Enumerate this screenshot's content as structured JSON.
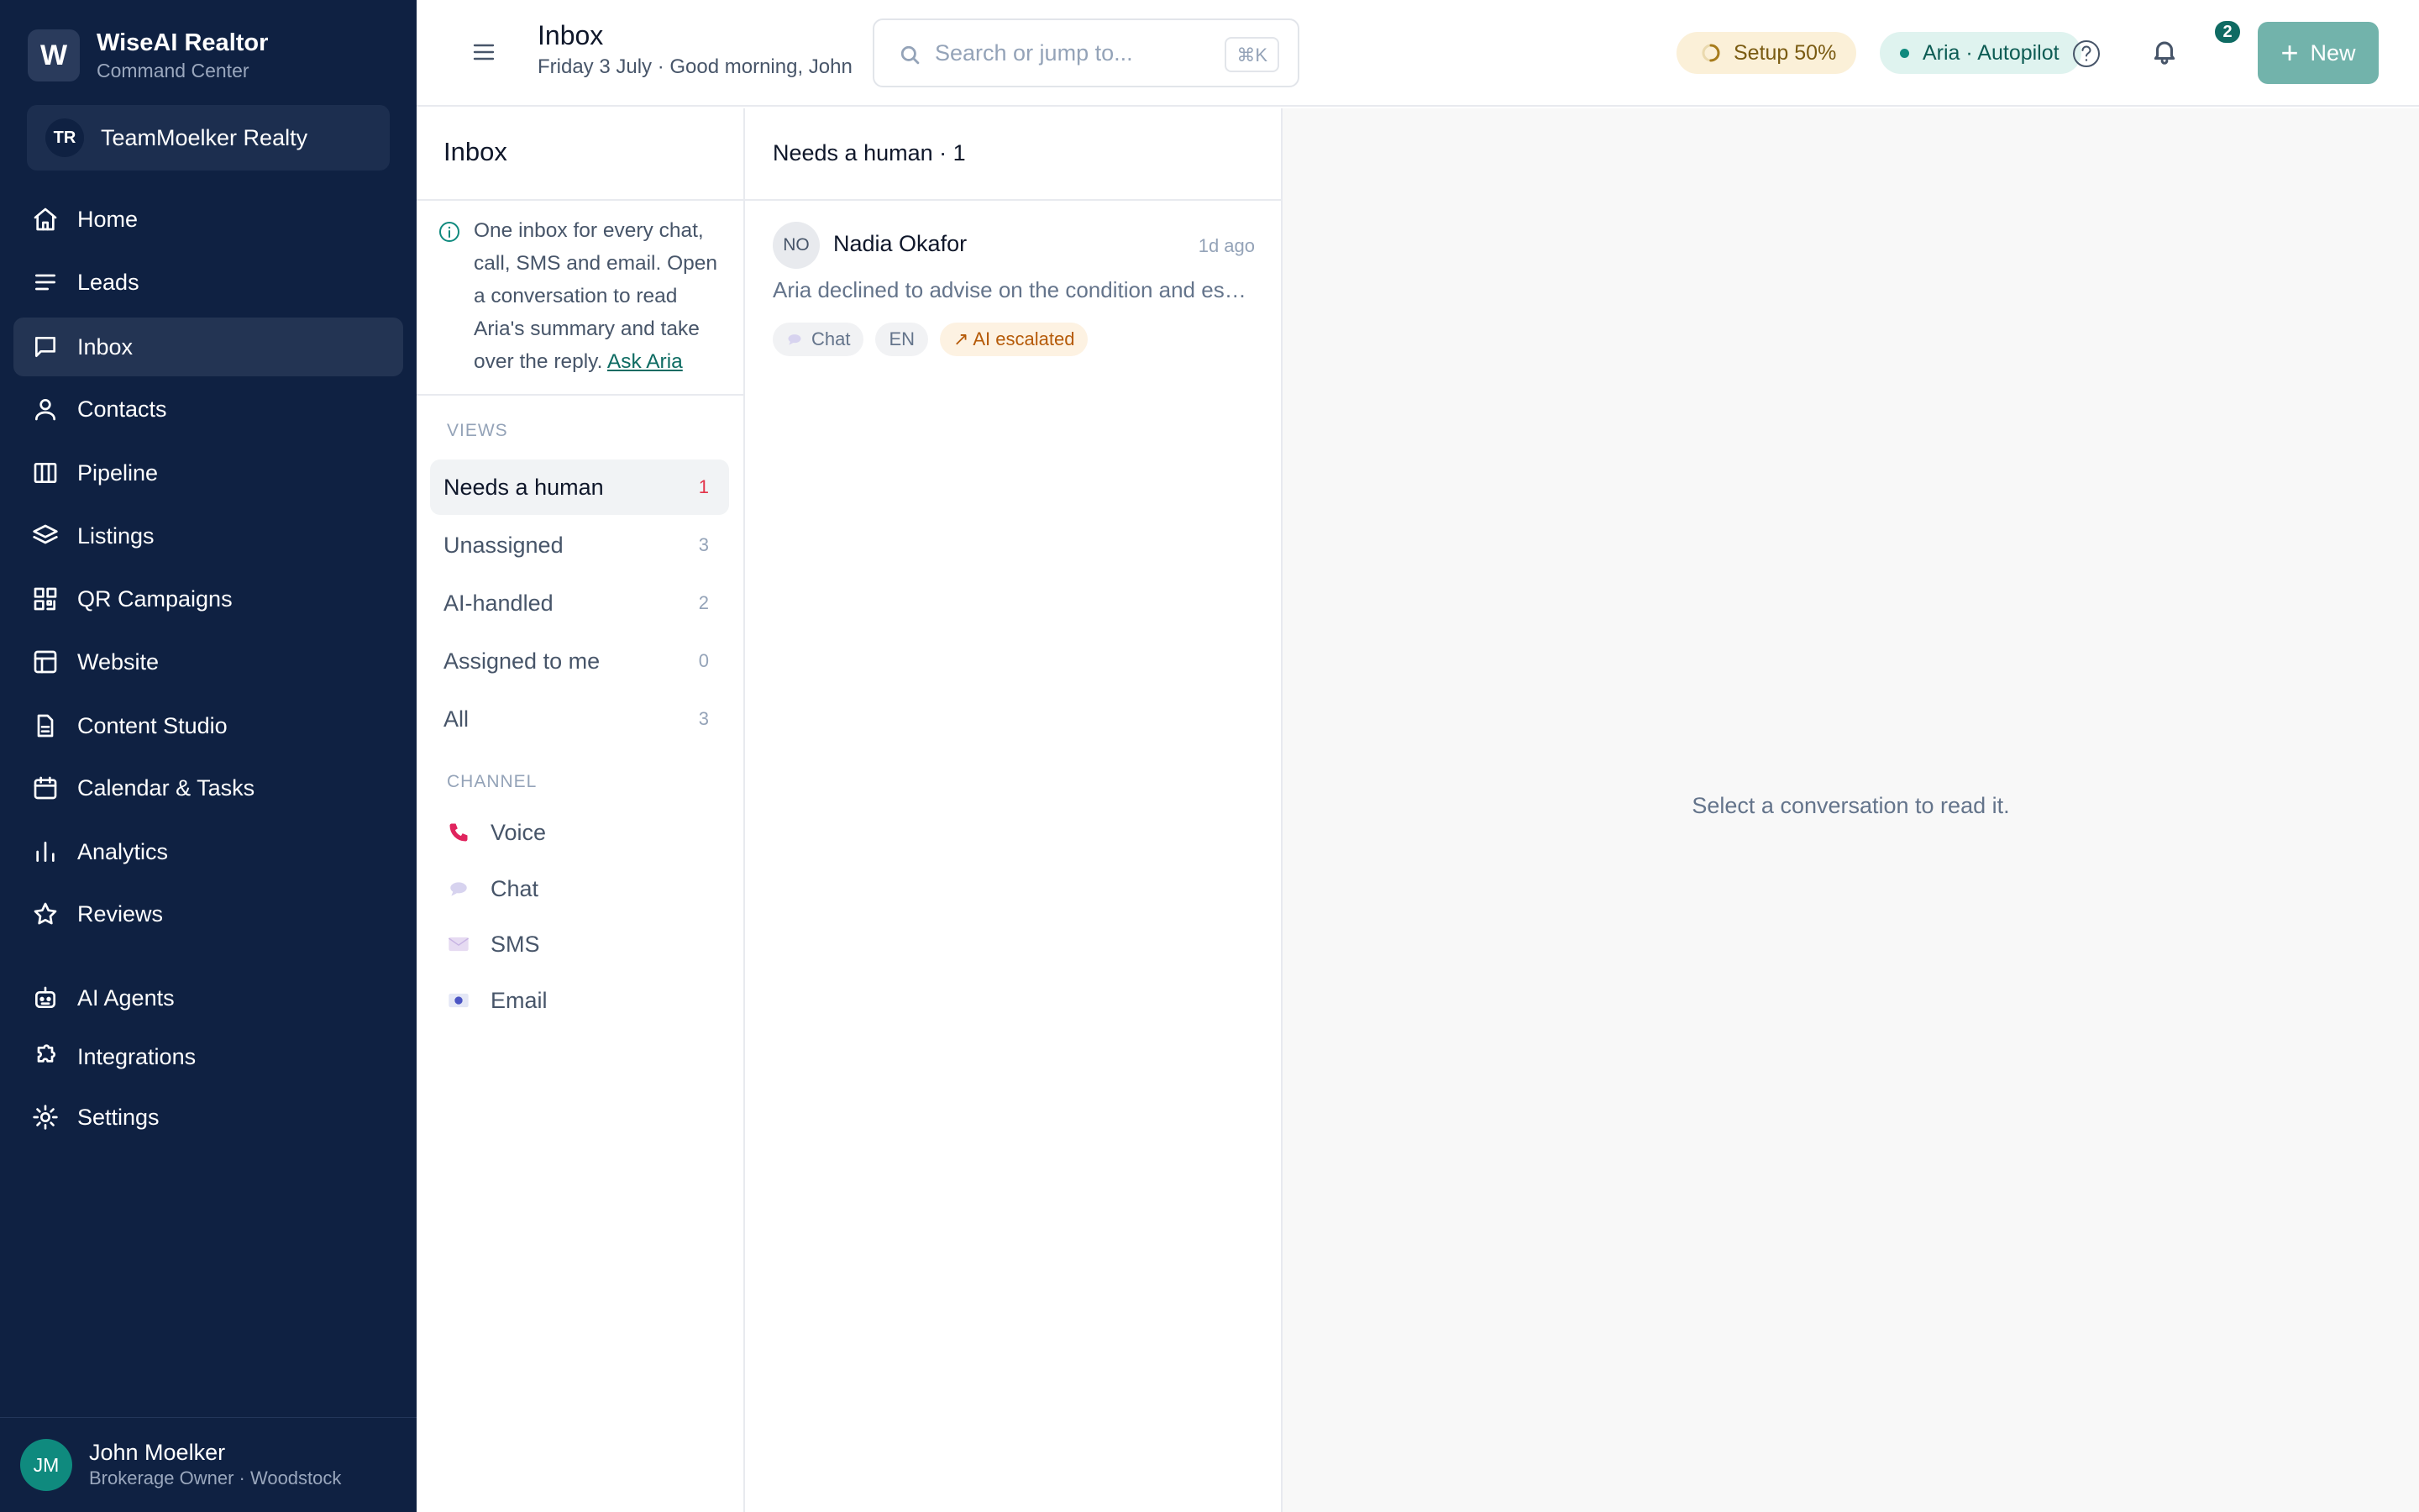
{
  "brand": {
    "initial": "W",
    "name": "WiseAI Realtor",
    "subtitle": "Command Center"
  },
  "team": {
    "initials": "TR",
    "name": "TeamMoelker Realty"
  },
  "nav": {
    "items": [
      {
        "label": "Home",
        "icon": "home-icon"
      },
      {
        "label": "Leads",
        "icon": "list-icon"
      },
      {
        "label": "Inbox",
        "icon": "message-square-icon",
        "active": true
      },
      {
        "label": "Contacts",
        "icon": "user-icon"
      },
      {
        "label": "Pipeline",
        "icon": "columns-icon"
      },
      {
        "label": "Listings",
        "icon": "layers-icon"
      },
      {
        "label": "QR Campaigns",
        "icon": "qr-code-icon"
      },
      {
        "label": "Website",
        "icon": "layout-icon"
      },
      {
        "label": "Content Studio",
        "icon": "file-text-icon"
      },
      {
        "label": "Calendar & Tasks",
        "icon": "calendar-icon"
      },
      {
        "label": "Analytics",
        "icon": "bar-chart-icon"
      },
      {
        "label": "Reviews",
        "icon": "star-icon"
      },
      {
        "label": "AI Agents",
        "icon": "bot-icon"
      },
      {
        "label": "Integrations",
        "icon": "puzzle-icon"
      },
      {
        "label": "Settings",
        "icon": "settings-icon"
      }
    ]
  },
  "user": {
    "initials": "JM",
    "name": "John Moelker",
    "role": "Brokerage Owner · Woodstock"
  },
  "header": {
    "title": "Inbox",
    "subtitle": "Friday 3 July · Good morning, John",
    "search_placeholder": "Search or jump to...",
    "search_shortcut": "⌘K",
    "setup_label": "Setup 50%",
    "setup_progress": 0.5,
    "aria_label": "Aria · Autopilot",
    "notifications_count": "2",
    "new_button_label": "New"
  },
  "inbox_panel": {
    "title": "Inbox",
    "info_text": "One inbox for every chat, call, SMS and email. Open a conversation to read Aria's summary and take over the reply.",
    "info_link": "Ask Aria",
    "views_label": "VIEWS",
    "views": [
      {
        "label": "Needs a human",
        "count": "1",
        "active": true
      },
      {
        "label": "Unassigned",
        "count": "3"
      },
      {
        "label": "AI-handled",
        "count": "2"
      },
      {
        "label": "Assigned to me",
        "count": "0"
      },
      {
        "label": "All",
        "count": "3"
      }
    ],
    "channel_label": "CHANNEL",
    "channels": [
      {
        "label": "Voice",
        "icon": "phone-icon"
      },
      {
        "label": "Chat",
        "icon": "speech-bubble-icon"
      },
      {
        "label": "SMS",
        "icon": "sms-icon"
      },
      {
        "label": "Email",
        "icon": "email-icon"
      }
    ]
  },
  "conversation_list": {
    "heading": "Needs a human · 1",
    "items": [
      {
        "initials": "NO",
        "name": "Nadia Okafor",
        "time": "1d ago",
        "preview": "Aria declined to advise on the condition and escalated the conversation to a human.",
        "tags": {
          "channel": "Chat",
          "language": "EN",
          "status": "↗ AI escalated"
        }
      }
    ]
  },
  "detail": {
    "empty_message": "Select a conversation to read it."
  },
  "colors": {
    "sidebar_bg": "#0f2142",
    "accent": "#0f8a7e",
    "new_button": "#72b3ab",
    "active_count": "#e3344a",
    "escalated": "#b55a08"
  }
}
